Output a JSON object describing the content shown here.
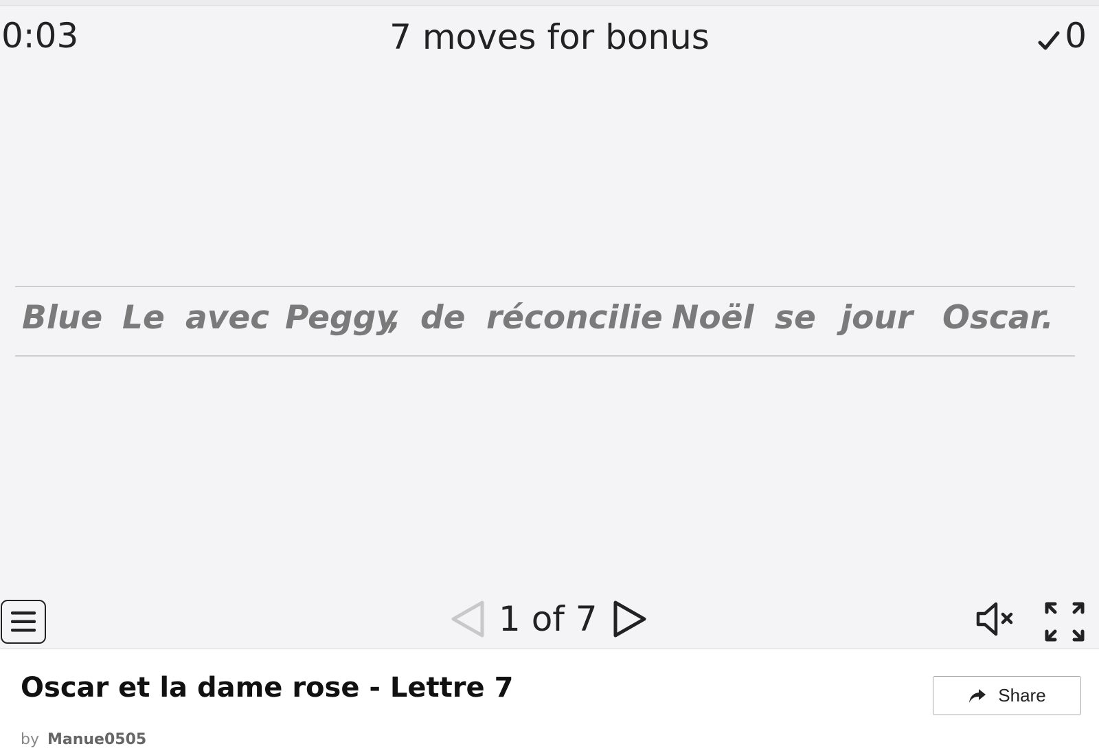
{
  "game": {
    "timer": "0:03",
    "bonus_text": "7 moves for bonus",
    "score": "0",
    "words": [
      "Blue",
      "Le",
      "avec",
      "Peggy",
      ",",
      "de",
      "réconcilie",
      "Noël",
      "se",
      "jour",
      "Oscar",
      "."
    ]
  },
  "controls": {
    "page_indicator": "1 of 7",
    "icons": {
      "menu": "menu-icon",
      "prev": "triangle-left-icon",
      "next": "triangle-right-icon",
      "mute": "speaker-muted-icon",
      "fullscreen": "fullscreen-icon",
      "score": "checkmark-icon"
    }
  },
  "activity": {
    "title": "Oscar et la dame rose - Lettre 7",
    "by_label": "by",
    "author": "Manue0505",
    "share_label": "Share"
  },
  "colors": {
    "stage_bg": "#f4f3f5",
    "word_color": "#7a7a7a",
    "text_dark": "#222222",
    "prev_disabled": "#c8c8c8"
  }
}
